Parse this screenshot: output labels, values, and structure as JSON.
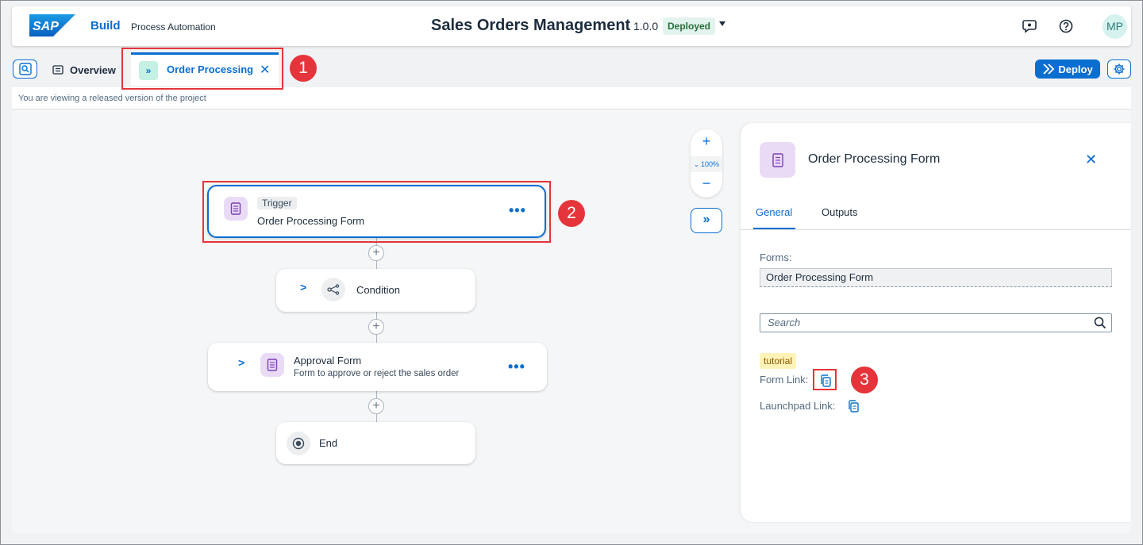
{
  "shell": {
    "logo": "SAP",
    "brand": "Build",
    "app_name": "Process Automation",
    "project_title": "Sales Orders Management",
    "version": "1.0.0",
    "status": "Deployed",
    "avatar_initials": "MP"
  },
  "tabs": {
    "overview": "Overview",
    "active": "Order Processing",
    "active_icon": "»"
  },
  "toolbar": {
    "deploy_label": "Deploy"
  },
  "info_bar": {
    "message": "You are viewing a released version of the project"
  },
  "process": {
    "trigger": {
      "badge": "Trigger",
      "name": "Order Processing Form"
    },
    "condition": {
      "name": "Condition"
    },
    "approval": {
      "name": "Approval Form",
      "description": "Form to approve or reject the sales order"
    },
    "end": {
      "name": "End"
    }
  },
  "zoom": {
    "level": "100%"
  },
  "panel": {
    "title": "Order Processing Form",
    "tabs": [
      "General",
      "Outputs"
    ],
    "forms_label": "Forms:",
    "forms_value": "Order Processing Form",
    "search_placeholder": "Search",
    "tag": "tutorial",
    "form_link_label": "Form Link:",
    "launchpad_link_label": "Launchpad Link:"
  },
  "annotations": [
    "1",
    "2",
    "3"
  ],
  "colors": {
    "accent": "#0a6ed1",
    "highlight": "#e5343b",
    "deployed_bg": "#e3f3ee"
  }
}
